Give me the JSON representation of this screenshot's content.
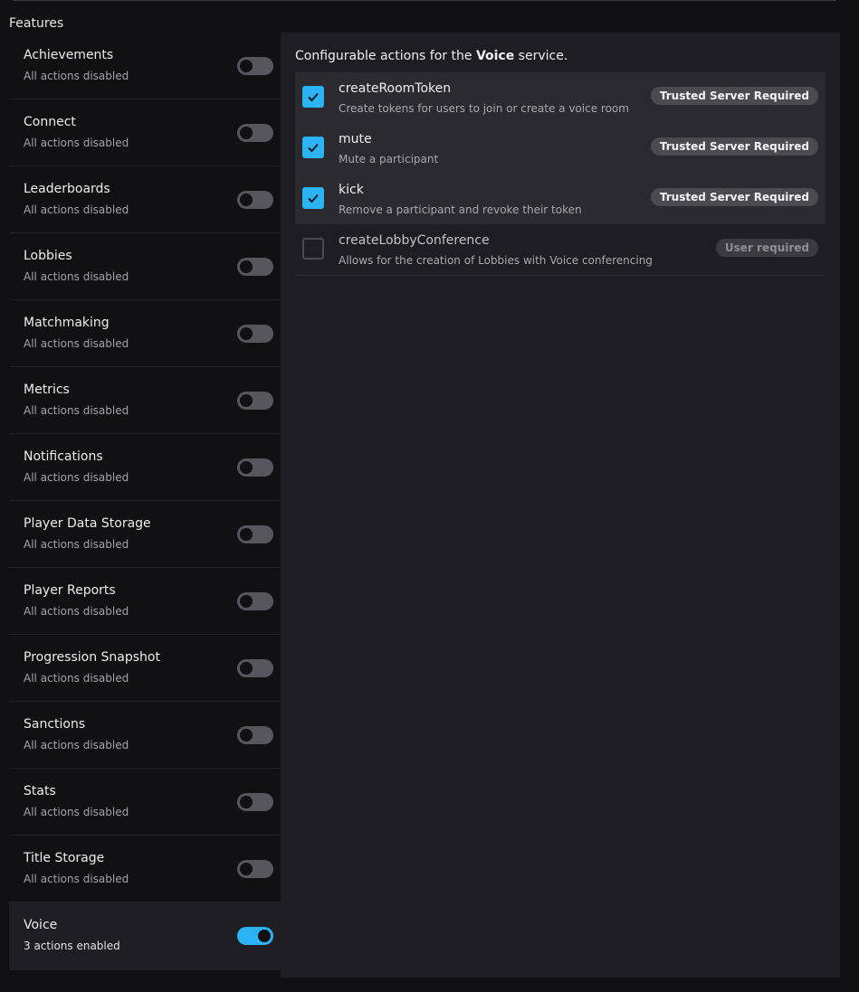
{
  "features_title": "Features",
  "sidebar": {
    "items": [
      {
        "name": "Achievements",
        "status": "All actions disabled",
        "enabled": false
      },
      {
        "name": "Connect",
        "status": "All actions disabled",
        "enabled": false
      },
      {
        "name": "Leaderboards",
        "status": "All actions disabled",
        "enabled": false
      },
      {
        "name": "Lobbies",
        "status": "All actions disabled",
        "enabled": false
      },
      {
        "name": "Matchmaking",
        "status": "All actions disabled",
        "enabled": false
      },
      {
        "name": "Metrics",
        "status": "All actions disabled",
        "enabled": false
      },
      {
        "name": "Notifications",
        "status": "All actions disabled",
        "enabled": false
      },
      {
        "name": "Player Data Storage",
        "status": "All actions disabled",
        "enabled": false
      },
      {
        "name": "Player Reports",
        "status": "All actions disabled",
        "enabled": false
      },
      {
        "name": "Progression Snapshot",
        "status": "All actions disabled",
        "enabled": false
      },
      {
        "name": "Sanctions",
        "status": "All actions disabled",
        "enabled": false
      },
      {
        "name": "Stats",
        "status": "All actions disabled",
        "enabled": false
      },
      {
        "name": "Title Storage",
        "status": "All actions disabled",
        "enabled": false
      },
      {
        "name": "Voice",
        "status": "3 actions enabled",
        "enabled": true
      }
    ]
  },
  "panel": {
    "heading_prefix": "Configurable actions for the ",
    "service_name": "Voice",
    "heading_suffix": " service.",
    "actions": [
      {
        "name": "createRoomToken",
        "description": "Create tokens for users to join or create a voice room",
        "badge": "Trusted Server Required",
        "checked": true
      },
      {
        "name": "mute",
        "description": "Mute a participant",
        "badge": "Trusted Server Required",
        "checked": true
      },
      {
        "name": "kick",
        "description": "Remove a participant and revoke their token",
        "badge": "Trusted Server Required",
        "checked": true
      },
      {
        "name": "createLobbyConference",
        "description": "Allows for the creation of Lobbies with Voice conferencing",
        "badge": "User required",
        "checked": false
      }
    ]
  },
  "colors": {
    "accent": "#2bb3f5",
    "background": "#111114",
    "panel": "#1e1e22"
  }
}
